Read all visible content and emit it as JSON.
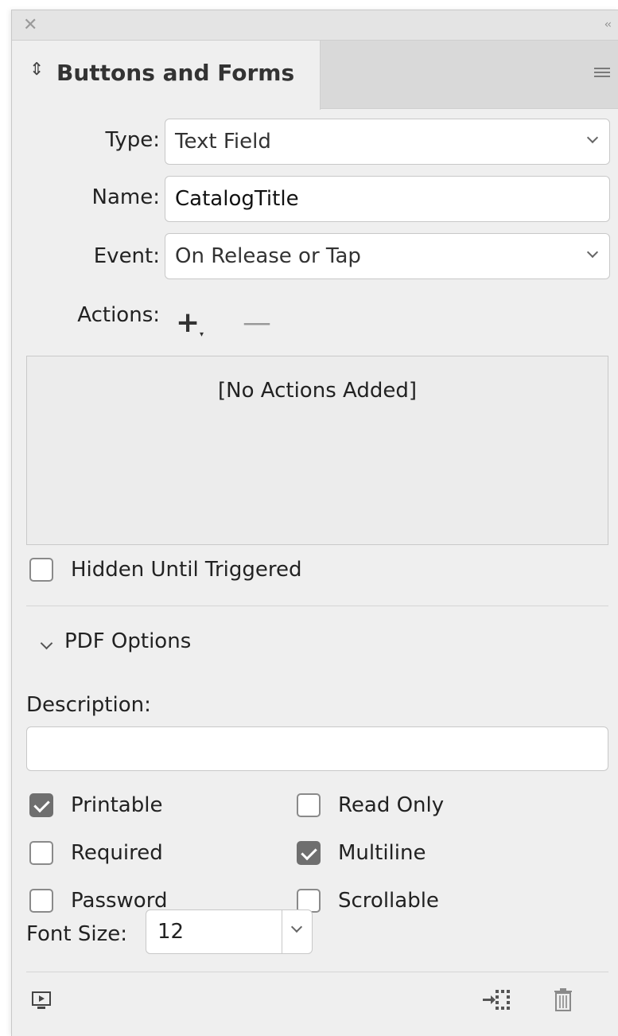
{
  "window": {
    "close_glyph": "✕",
    "collapse_glyph": "‹‹"
  },
  "tab": {
    "updown_glyph": "⇕",
    "title": "Buttons and Forms"
  },
  "form": {
    "type_label": "Type:",
    "type_value": "Text Field",
    "name_label": "Name:",
    "name_value": "CatalogTitle",
    "event_label": "Event:",
    "event_value": "On Release or Tap",
    "actions_label": "Actions:",
    "actions_add_glyph": "+",
    "actions_remove_glyph": "—",
    "actions_empty": "[No Actions Added]"
  },
  "hidden_until_triggered": {
    "label": "Hidden Until Triggered",
    "checked": false
  },
  "pdf_options": {
    "title": "PDF Options",
    "description_label": "Description:",
    "description_value": "",
    "checkboxes": [
      {
        "label": "Printable",
        "checked": true
      },
      {
        "label": "Read Only",
        "checked": false
      },
      {
        "label": "Required",
        "checked": false
      },
      {
        "label": "Multiline",
        "checked": true
      },
      {
        "label": "Password",
        "checked": false
      },
      {
        "label": "Scrollable",
        "checked": false
      }
    ],
    "font_size_label": "Font Size:",
    "font_size_value": "12"
  },
  "icons": {
    "preview": "preview-spread-icon",
    "convert": "convert-to-object-icon",
    "delete": "trash-icon"
  }
}
